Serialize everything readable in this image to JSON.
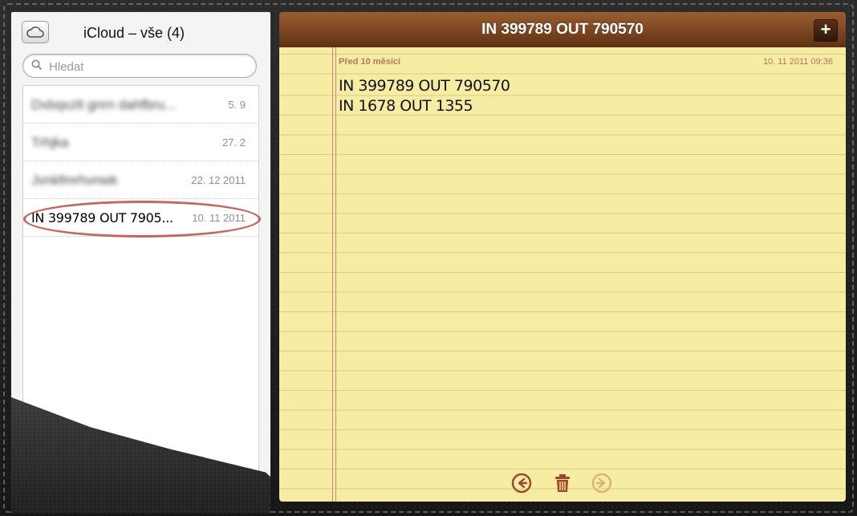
{
  "sidebar": {
    "icon": "cloud-icon",
    "title": "iCloud – vše (4)",
    "search_placeholder": "Hledat",
    "items": [
      {
        "title": "Dxbqxzlt gnrn dahfbru...",
        "date": "5. 9"
      },
      {
        "title": "Trhjka",
        "date": "27. 2"
      },
      {
        "title": "Jvnkfmrhvnwk",
        "date": "22. 12 2011"
      },
      {
        "title": "IN 399789 OUT 7905...",
        "date": "10. 11 2011"
      }
    ]
  },
  "note": {
    "title": "IN 399789 OUT 790570",
    "add_label": "+",
    "ago": "Před 10 měsíci",
    "timestamp": "10. 11 2011 09:36",
    "lines": [
      "IN 399789 OUT 790570",
      "IN 1678 OUT 1355"
    ]
  },
  "toolbar": {
    "icons": [
      "back-arrow-icon",
      "trash-icon",
      "forward-arrow-icon"
    ]
  },
  "colors": {
    "paper": "#f6eca2",
    "header_brown": "#7a4520",
    "accent_red": "#b84c44"
  }
}
